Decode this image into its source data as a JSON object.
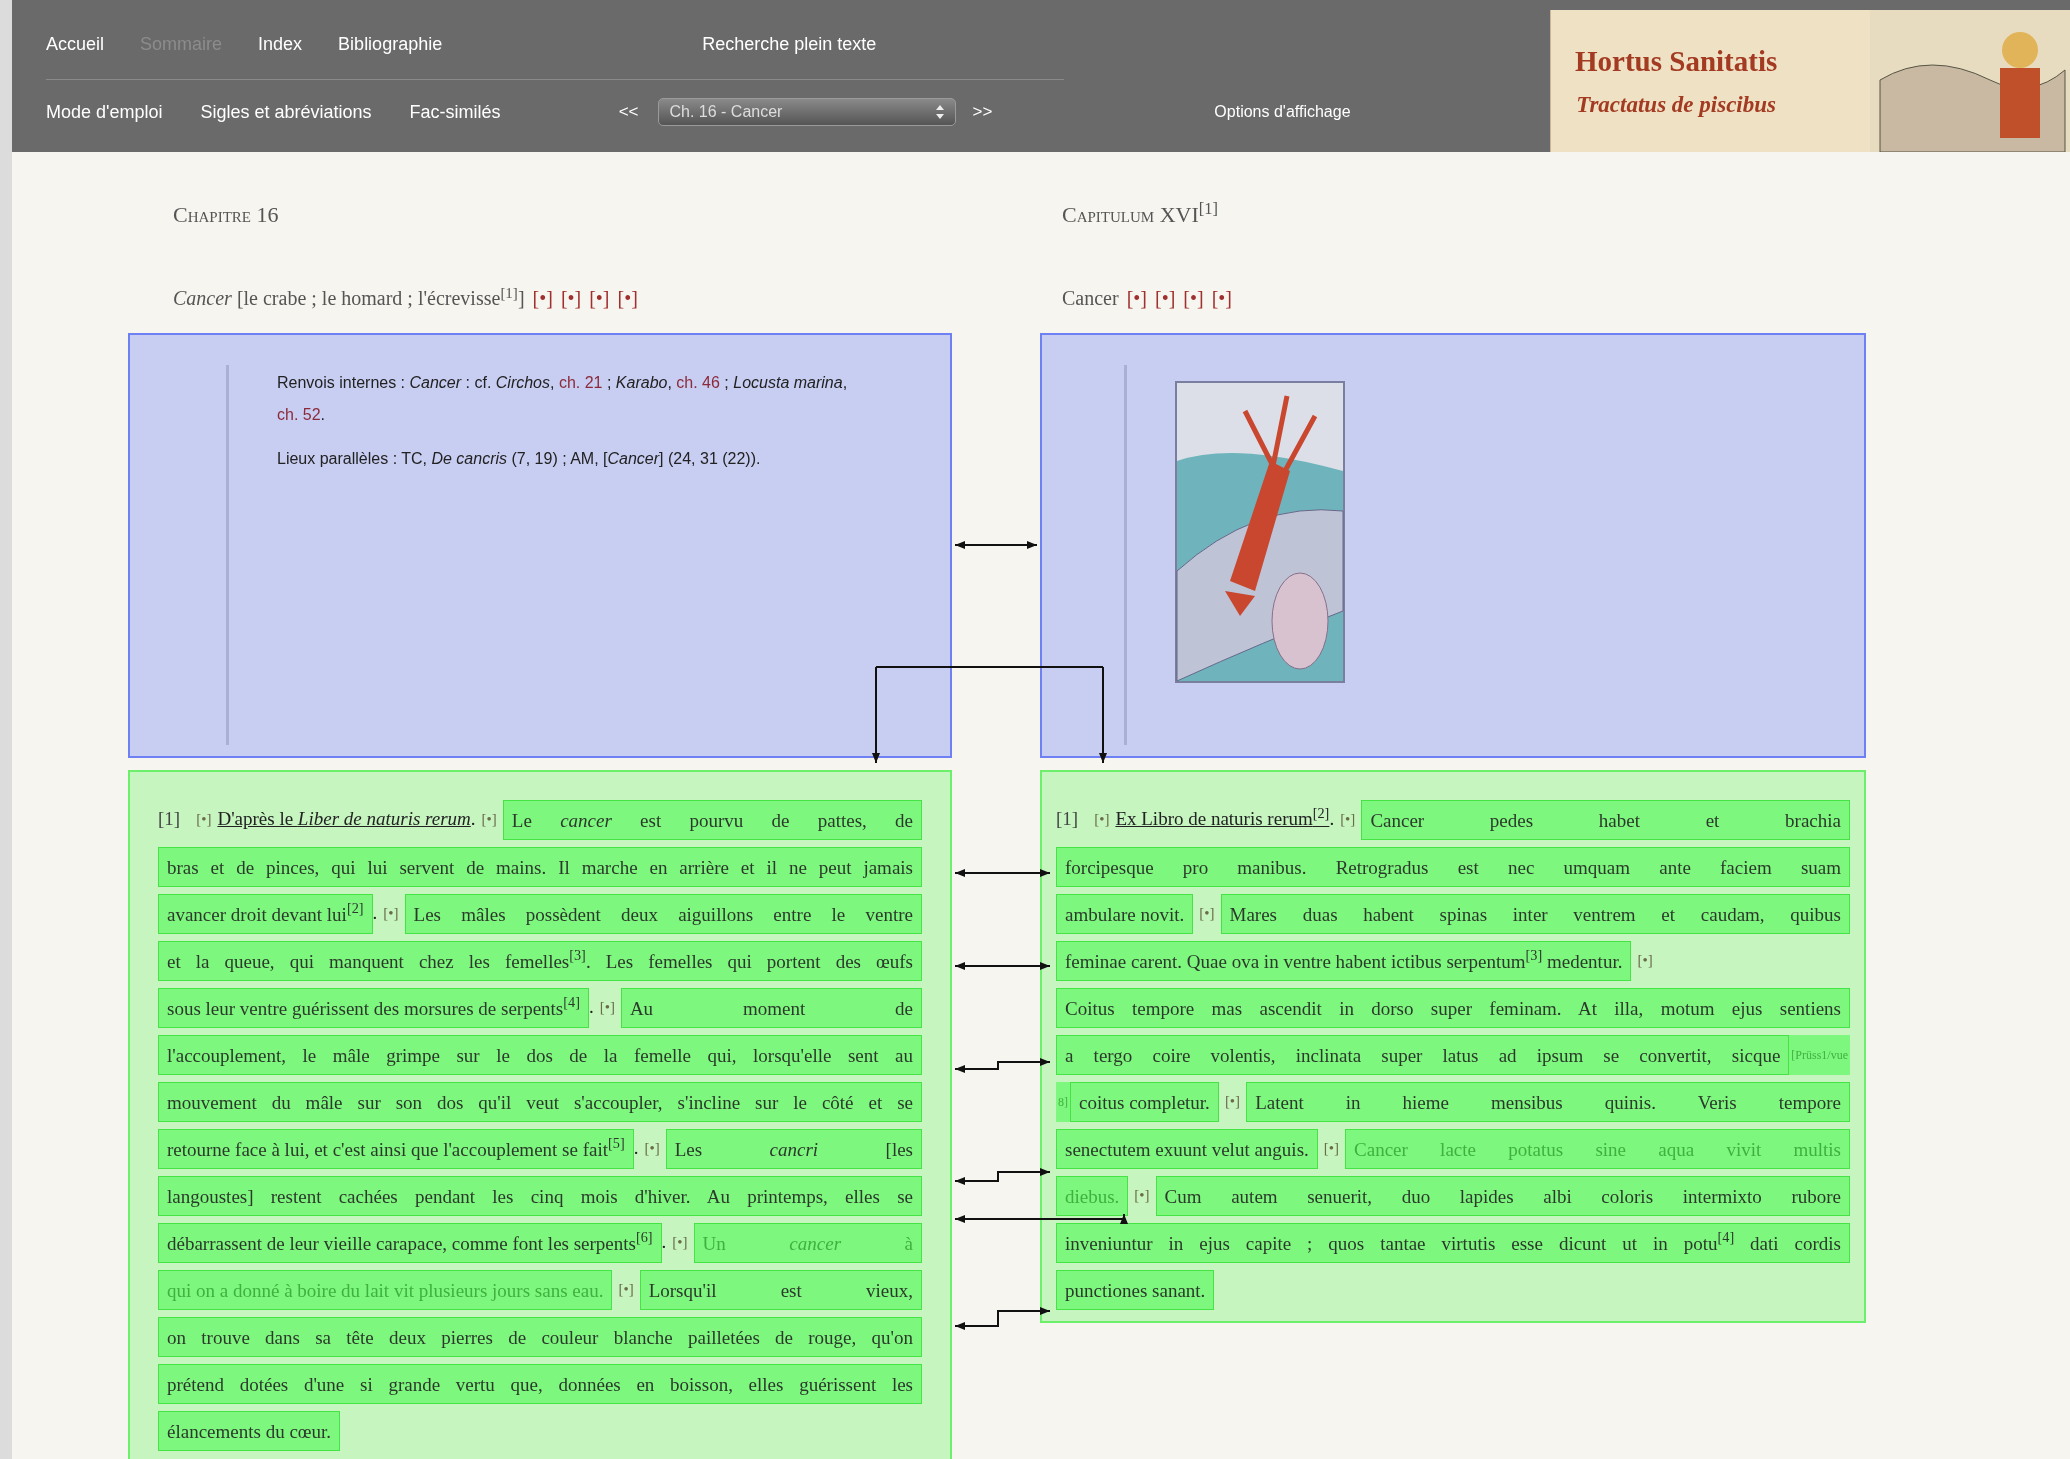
{
  "nav": {
    "row1": [
      {
        "label": "Accueil",
        "selected": false
      },
      {
        "label": "Sommaire",
        "selected": true
      },
      {
        "label": "Index",
        "selected": false
      },
      {
        "label": "Bibliographie",
        "selected": false
      }
    ],
    "search": "Recherche plein texte",
    "row2": [
      {
        "label": "Mode d'emploi",
        "selected": false
      },
      {
        "label": "Sigles et abréviations",
        "selected": false
      },
      {
        "label": "Fac-similés",
        "selected": false
      }
    ],
    "chapter_select": {
      "prev": "<<",
      "value": "Ch. 16 - Cancer",
      "next": ">>"
    },
    "display_options": "Options d'affichage"
  },
  "logo": {
    "title": "Hortus Sanitatis",
    "subtitle": "Tractatus de piscibus"
  },
  "left": {
    "heading": "Chapitre 16",
    "lemma": "*Cancer* [le crabe ; le homard ; l'écrevisse$^{[1]}$]",
    "markers": [
      "[•]",
      "[•]",
      "[•]",
      "[•]"
    ],
    "notes": [
      [
        {
          "kind": "text",
          "t": "Renvois internes : *Cancer* : cf. *Circhos*, "
        },
        {
          "kind": "link",
          "t": "ch. 21"
        },
        {
          "kind": "text",
          "t": " ; *Karabo*, "
        },
        {
          "kind": "link",
          "t": "ch. 46"
        },
        {
          "kind": "text",
          "t": " ; *Locusta marina*, "
        },
        {
          "kind": "link",
          "t": "ch. 52"
        },
        {
          "kind": "text",
          "t": "."
        }
      ],
      [
        {
          "kind": "text",
          "t": "Lieux parallèles : TC, *De cancris* (7, 19) ; AM, [*Cancer*] (24, 31 (22))."
        }
      ]
    ],
    "lines": [
      [
        {
          "kind": "num",
          "t": "[1]"
        },
        {
          "kind": "marker",
          "t": "[•]"
        },
        {
          "kind": "title",
          "t": "D'après le *Liber de naturis rerum*"
        },
        {
          "kind": "plain",
          "t": "."
        },
        {
          "kind": "marker",
          "t": "[•]"
        },
        {
          "kind": "hl",
          "t": "Le *cancer* est pourvu de pattes, de"
        }
      ],
      [
        {
          "kind": "hl",
          "t": "bras et de pinces, qui lui servent de mains. Il marche en arrière et il ne peut jamais"
        }
      ],
      [
        {
          "kind": "hl",
          "t": "avancer droit devant lui$^{[2]}$"
        },
        {
          "kind": "plain",
          "t": "."
        },
        {
          "kind": "marker",
          "t": "[•]"
        },
        {
          "kind": "hl",
          "t": "Les mâles possèdent deux aiguillons entre le ventre"
        }
      ],
      [
        {
          "kind": "hl",
          "t": "et la queue, qui manquent chez les femelles$^{[3]}$. Les femelles qui portent des œufs"
        }
      ],
      [
        {
          "kind": "hl",
          "t": "sous leur ventre guérissent des morsures de serpents$^{[4]}$"
        },
        {
          "kind": "plain",
          "t": "."
        },
        {
          "kind": "marker",
          "t": "[•]"
        },
        {
          "kind": "hl",
          "t": "Au moment de"
        }
      ],
      [
        {
          "kind": "hl",
          "t": "l'accouplement, le mâle grimpe sur le dos de la femelle qui, lorsqu'elle sent au"
        }
      ],
      [
        {
          "kind": "hl",
          "t": "mouvement du mâle sur son dos qu'il veut s'accoupler, s'incline sur le côté et se"
        }
      ],
      [
        {
          "kind": "hl",
          "t": "retourne face à lui, et c'est ainsi que l'accouplement se fait$^{[5]}$"
        },
        {
          "kind": "plain",
          "t": "."
        },
        {
          "kind": "marker",
          "t": "[•]"
        },
        {
          "kind": "hl",
          "t": "Les *cancri* [les"
        }
      ],
      [
        {
          "kind": "hl",
          "t": "langoustes] restent cachées pendant les cinq mois d'hiver. Au printemps, elles se"
        }
      ],
      [
        {
          "kind": "hl",
          "t": "débarrassent de leur vieille carapace, comme font les serpents$^{[6]}$"
        },
        {
          "kind": "plain",
          "t": "."
        },
        {
          "kind": "marker",
          "t": "[•]"
        },
        {
          "kind": "faded",
          "t": "Un *cancer* à"
        }
      ],
      [
        {
          "kind": "faded",
          "t": "qui on a donné à boire du lait vit plusieurs jours sans eau."
        },
        {
          "kind": "marker",
          "t": "[•]"
        },
        {
          "kind": "hl",
          "t": "Lorsqu'il est vieux,"
        }
      ],
      [
        {
          "kind": "hl",
          "t": "on trouve dans sa tête deux pierres de couleur blanche pailletées de rouge, qu'on"
        }
      ],
      [
        {
          "kind": "hl",
          "t": "prétend dotées d'une si grande vertu que, données en boisson, elles guérissent les"
        }
      ],
      [
        {
          "kind": "hl",
          "t": "élancements du cœur."
        }
      ]
    ]
  },
  "right": {
    "heading": "Capitulum XVI$^{[1]}$",
    "lemma": "Cancer",
    "markers": [
      "[•]",
      "[•]",
      "[•]",
      "[•]"
    ],
    "lines": [
      [
        {
          "kind": "num",
          "t": "[1]"
        },
        {
          "kind": "marker",
          "t": "[•]"
        },
        {
          "kind": "title",
          "t": "Ex Libro de naturis rerum$^{[2]}$"
        },
        {
          "kind": "plain",
          "t": "."
        },
        {
          "kind": "marker",
          "t": "[•]"
        },
        {
          "kind": "hl",
          "t": "Cancer pedes habet et brachia"
        }
      ],
      [
        {
          "kind": "hl",
          "t": "forcipesque pro manibus. Retrogradus est nec umquam ante faciem suam"
        }
      ],
      [
        {
          "kind": "hl",
          "t": "ambulare novit."
        },
        {
          "kind": "marker",
          "t": "[•]"
        },
        {
          "kind": "hl",
          "t": "Mares duas habent spinas inter ventrem et caudam, quibus"
        }
      ],
      [
        {
          "kind": "hl",
          "t": "feminae carent. Quae ova in ventre habent ictibus serpentum$^{[3]}$ medentur."
        },
        {
          "kind": "marker",
          "t": "[•]"
        }
      ],
      [
        {
          "kind": "hl",
          "t": "Coitus tempore mas ascendit in dorso super feminam. At illa, motum ejus sentiens"
        }
      ],
      [
        {
          "kind": "hl",
          "t": "a tergo coire volentis, inclinata super latus ad ipsum se convertit, sicque"
        },
        {
          "kind": "ref",
          "t": "[Prüss1/vue"
        }
      ],
      [
        {
          "kind": "ref",
          "t": "8]"
        },
        {
          "kind": "hl",
          "t": "coitus completur."
        },
        {
          "kind": "marker",
          "t": "[•]"
        },
        {
          "kind": "hl",
          "t": "Latent in hieme mensibus quinis. Veris tempore"
        }
      ],
      [
        {
          "kind": "hl",
          "t": "senectutem exuunt velut anguis."
        },
        {
          "kind": "marker",
          "t": "[•]"
        },
        {
          "kind": "faded",
          "t": "Cancer lacte potatus sine aqua vivit multis"
        }
      ],
      [
        {
          "kind": "faded",
          "t": "diebus."
        },
        {
          "kind": "marker",
          "t": "[•]"
        },
        {
          "kind": "hl",
          "t": "Cum autem senuerit, duo lapides albi coloris intermixto rubore"
        }
      ],
      [
        {
          "kind": "hl",
          "t": "inveniuntur in ejus capite ; quos tantae virtutis esse dicunt ut in potu$^{[4]}$ dati cordis"
        }
      ],
      [
        {
          "kind": "hl",
          "t": "punctiones sanant."
        }
      ]
    ]
  }
}
